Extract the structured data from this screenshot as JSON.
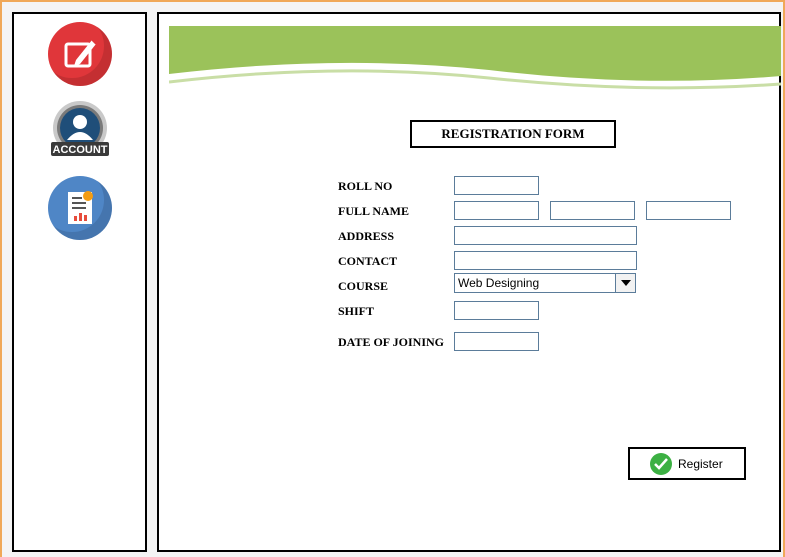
{
  "sidebar": {
    "items": [
      {
        "name": "edit",
        "icon": "edit-pencil-icon",
        "color": "#e0363a"
      },
      {
        "name": "account",
        "icon": "account-user-icon",
        "label": "ACCOUNT"
      },
      {
        "name": "report",
        "icon": "report-document-icon",
        "color": "#4f86c6"
      }
    ]
  },
  "banner": {
    "color": "#9bc25a"
  },
  "form": {
    "title": "REGISTRATION FORM",
    "labels": {
      "roll_no": "ROLL NO",
      "full_name": "FULL NAME",
      "address": "ADDRESS",
      "contact": "CONTACT",
      "course": "COURSE",
      "shift": "SHIFT",
      "date_of_joining": "DATE OF JOINING"
    },
    "values": {
      "roll_no": "",
      "first_name": "",
      "middle_name": "",
      "last_name": "",
      "address": "",
      "contact": "",
      "shift": "",
      "date_of_joining": ""
    },
    "course": {
      "selected": "Web Designing"
    },
    "register_label": "Register"
  }
}
